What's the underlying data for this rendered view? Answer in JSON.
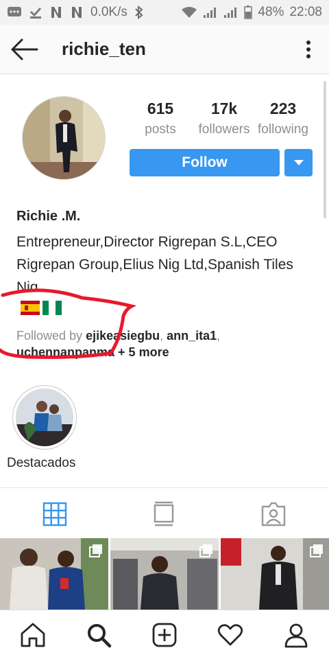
{
  "status_bar": {
    "network_speed": "0.0K/s",
    "battery_percent": "48%",
    "time": "22:08"
  },
  "header": {
    "username": "richie_ten",
    "back_icon": "arrow-left-icon",
    "more_icon": "vertical-dots-icon"
  },
  "profile": {
    "stats": {
      "posts_count": "615",
      "posts_label": "posts",
      "followers_count": "17k",
      "followers_label": "followers",
      "following_count": "223",
      "following_label": "following"
    },
    "follow_label": "Follow",
    "display_name": "Richie .M.",
    "bio": "Entrepreneur,Director Rigrepan S.L,CEO Rigrepan Group,Elius Nig Ltd,Spanish Tiles Nig",
    "flags": [
      "spain-flag-icon",
      "nigeria-flag-icon"
    ],
    "followed_by": {
      "prefix": "Followed by",
      "user1": "ejikeasiegbu",
      "sep1": ", ",
      "user2": "ann_ita1",
      "sep2": ",",
      "user3": "uchennanpanma",
      "more": "+ 5 more"
    }
  },
  "highlights": [
    {
      "label": "Destacados"
    }
  ],
  "tabs": [
    {
      "name": "grid",
      "icon": "grid-icon",
      "active": true
    },
    {
      "name": "feed",
      "icon": "feed-icon",
      "active": false
    },
    {
      "name": "tagged",
      "icon": "tagged-person-icon",
      "active": false
    }
  ],
  "bottom_nav": [
    {
      "icon": "home-icon"
    },
    {
      "icon": "search-icon"
    },
    {
      "icon": "add-post-icon"
    },
    {
      "icon": "heart-icon"
    },
    {
      "icon": "profile-icon"
    }
  ],
  "colors": {
    "accent": "#3897f0",
    "annotation": "#e8192c",
    "muted": "#8e8e8e"
  }
}
